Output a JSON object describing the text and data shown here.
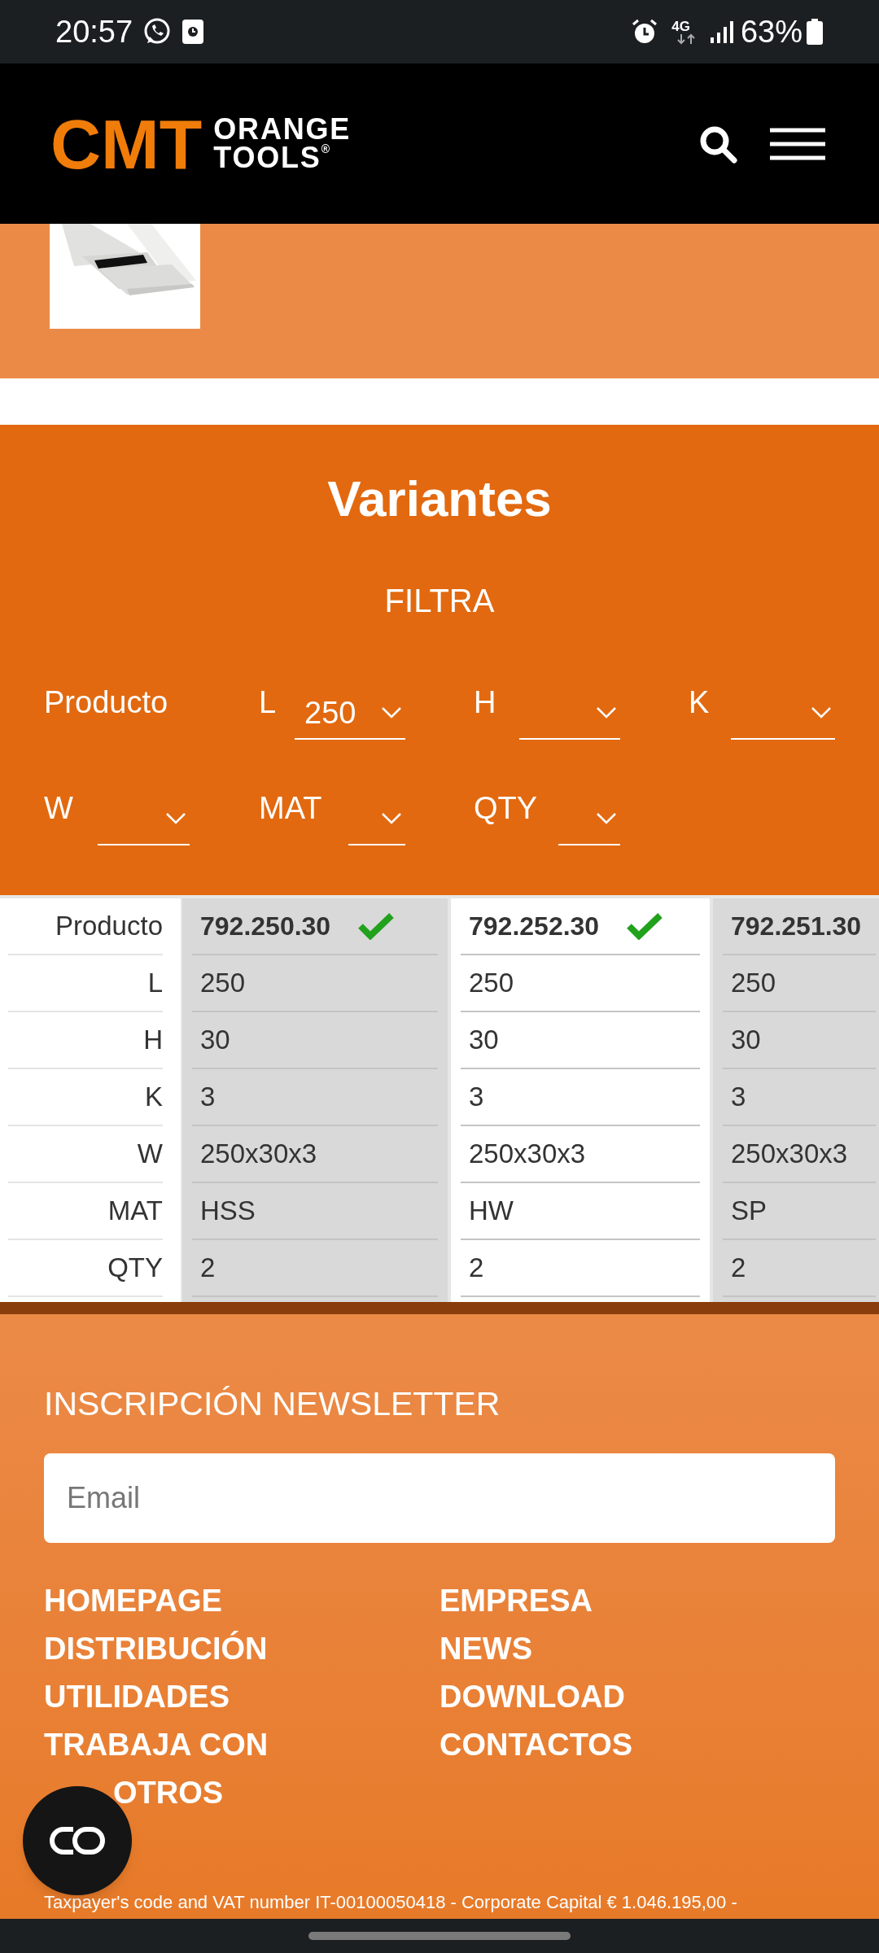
{
  "status_bar": {
    "time": "20:57",
    "network": "4G",
    "battery": "63%"
  },
  "header": {
    "logo_mark": "CMT",
    "logo_line_1": "ORANGE",
    "logo_line_2": "TOOLS",
    "logo_reg": "®"
  },
  "variants": {
    "title": "Variantes",
    "filter_heading": "FILTRA",
    "filters": [
      {
        "kind": "label",
        "label": "Producto"
      },
      {
        "kind": "select",
        "label": "L",
        "value": "250"
      },
      {
        "kind": "select",
        "label": "H"
      },
      {
        "kind": "select",
        "label": "K"
      },
      {
        "kind": "select",
        "label": "W"
      },
      {
        "kind": "select",
        "label": "MAT"
      },
      {
        "kind": "select",
        "label": "QTY"
      }
    ],
    "row_labels": [
      "Producto",
      "L",
      "H",
      "K",
      "W",
      "MAT",
      "QTY"
    ],
    "products": [
      {
        "code": "792.250.30",
        "checked": true,
        "shaded": true,
        "values": [
          "250",
          "30",
          "3",
          "250x30x3",
          "HSS",
          "2"
        ]
      },
      {
        "code": "792.252.30",
        "checked": true,
        "shaded": false,
        "values": [
          "250",
          "30",
          "3",
          "250x30x3",
          "HW",
          "2"
        ]
      },
      {
        "code": "792.251.30",
        "shaded": true,
        "values": [
          "250",
          "30",
          "3",
          "250x30x3",
          "SP",
          "2"
        ]
      }
    ]
  },
  "footer": {
    "newsletter_heading": "INSCRIPCIÓN NEWSLETTER",
    "email_placeholder": "Email",
    "links_left": [
      [
        "HOMEPAGE"
      ],
      [
        "DISTRIBUCIÓN"
      ],
      [
        "UTILIDADES"
      ],
      [
        "TRABAJA CON",
        "OTROS"
      ]
    ],
    "links_right": [
      [
        "EMPRESA"
      ],
      [
        "NEWS"
      ],
      [
        "DOWNLOAD"
      ],
      [
        "CONTACTOS"
      ]
    ],
    "legal": "Taxpayer's code and VAT number IT-00100050418 - Corporate Capital € 1.046.195,00 -"
  }
}
